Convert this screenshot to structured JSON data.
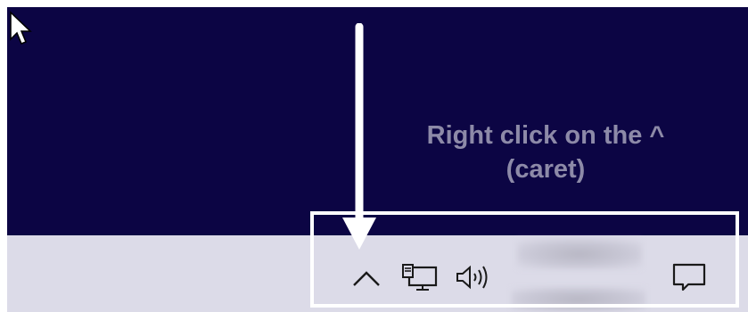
{
  "annotation": {
    "line1": "Right click on the ^",
    "line2": "(caret)"
  },
  "tray": {
    "icons": [
      "caret-up-icon",
      "network-icon",
      "volume-icon",
      "notification-icon"
    ],
    "clock": {
      "time": "",
      "date": ""
    }
  },
  "colors": {
    "desktop": "#0c0544",
    "taskbar": "#dcdbe8",
    "annotation_text": "#8d8aa8",
    "highlight": "#ffffff"
  }
}
